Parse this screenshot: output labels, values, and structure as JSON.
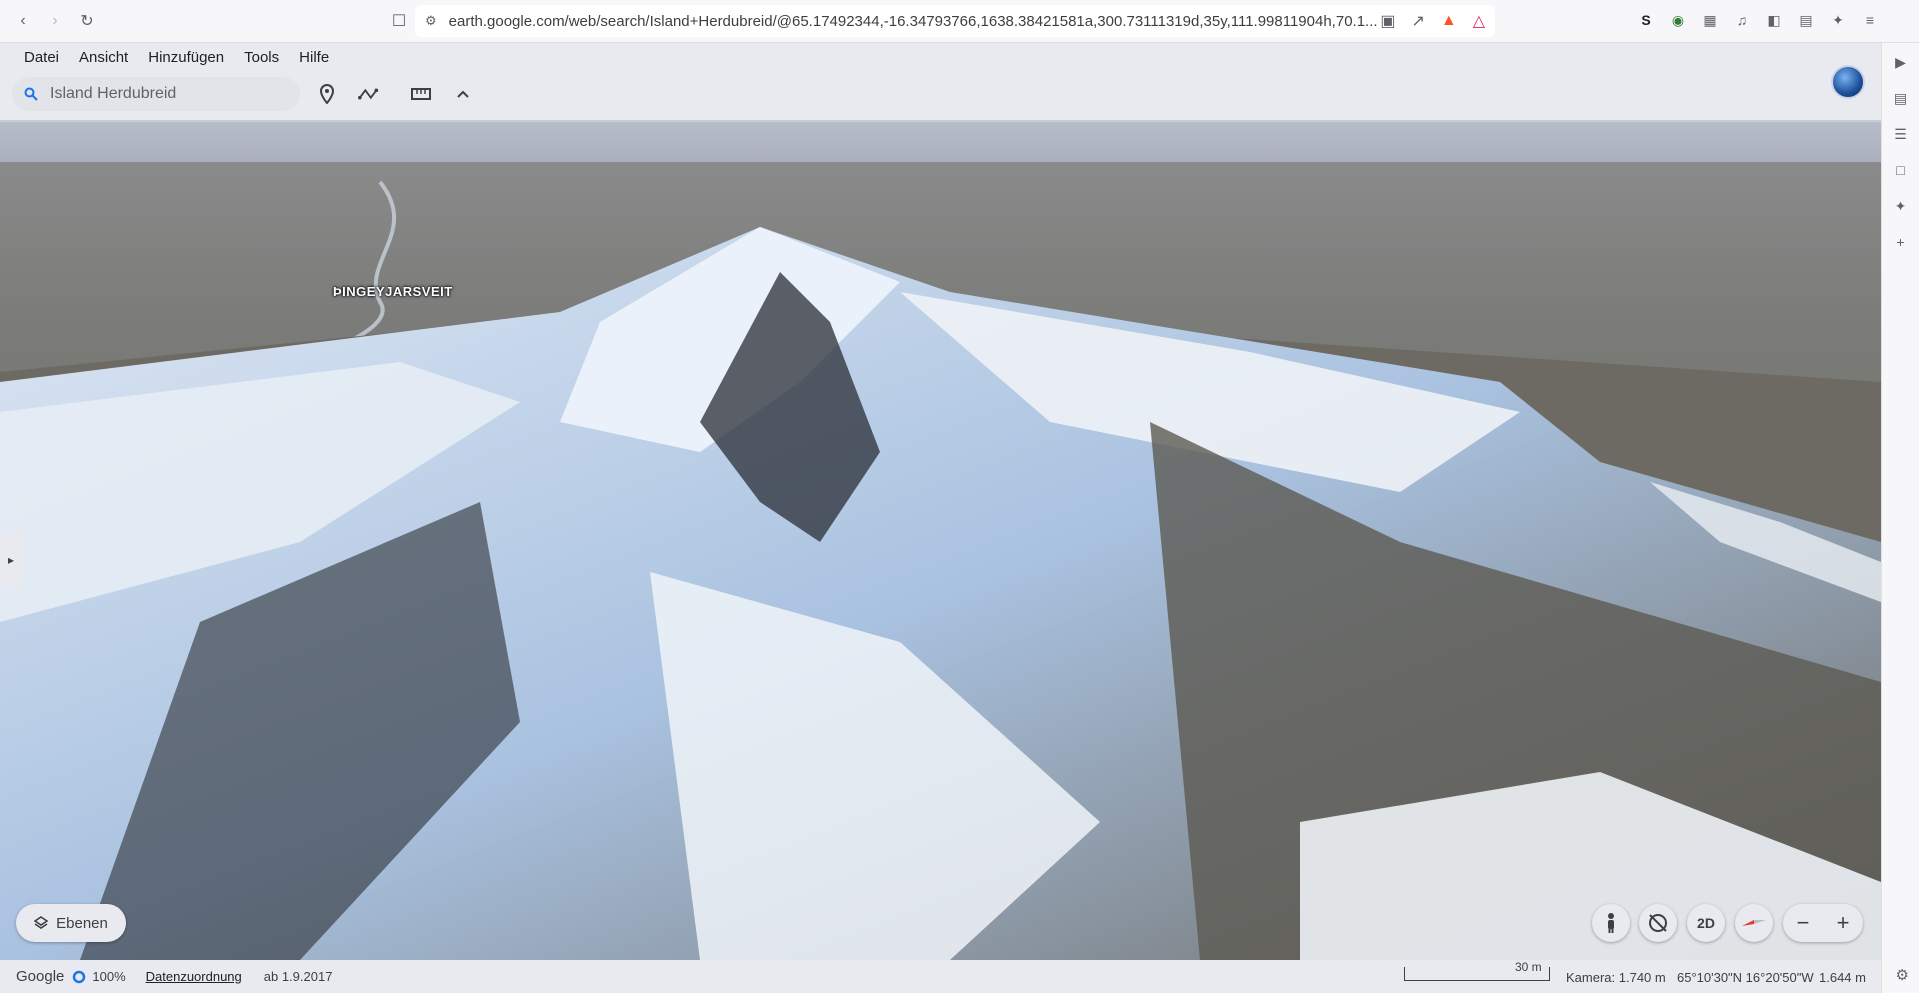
{
  "browser": {
    "url": "earth.google.com/web/search/Island+Herdubreid/@65.17492344,-16.34793766,1638.38421581a,300.73111319d,35y,111.99811904h,70.1..."
  },
  "menu": [
    "Datei",
    "Ansicht",
    "Hinzufügen",
    "Tools",
    "Hilfe"
  ],
  "search": {
    "value": "Island Herdubreid"
  },
  "map": {
    "place_label": "ÞINGEYJARSVEIT"
  },
  "controls": {
    "layers_label": "Ebenen",
    "mode_2d": "2D",
    "zoom_out": "−",
    "zoom_in": "+"
  },
  "status": {
    "brand": "Google",
    "loading_percent": "100%",
    "attribution_link": "Datenzuordnung",
    "imagery_date": "ab 1.9.2017",
    "scale_text": "30 m",
    "camera": "Kamera: 1.740 m",
    "coords": "65°10'30\"N 16°20'50\"W",
    "elevation": "1.644 m"
  },
  "colors": {
    "accent": "#1a73e8",
    "toolbar": "#e8eaef"
  }
}
